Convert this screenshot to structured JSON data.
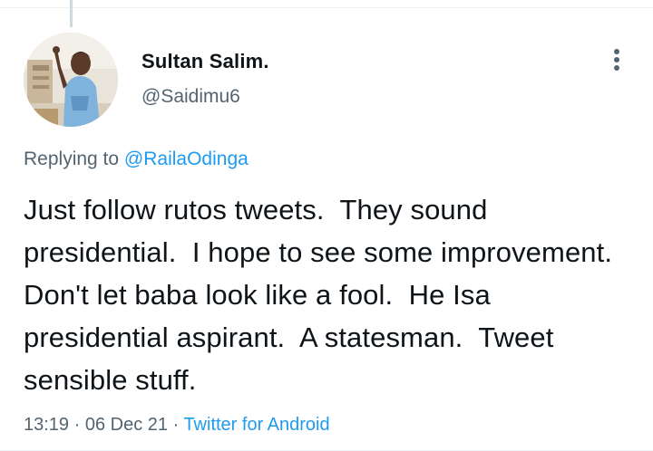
{
  "tweet": {
    "author_name": "Sultan Salim.",
    "author_handle": "@Saidimu6",
    "replying_prefix": "Replying to ",
    "replying_to": "@RailaOdinga",
    "text": "Just follow rutos tweets.  They sound presidential.  I hope to see some improvement.  Don't let baba look like a fool.  He Isa presidential aspirant.  A statesman.  Tweet sensible stuff.",
    "time": "13:19",
    "separator": " · ",
    "date": "06 Dec 21",
    "source": "Twitter for Android"
  },
  "icons": {
    "more": "more-vertical-icon",
    "avatar": "profile-photo"
  },
  "colors": {
    "accent": "#1d9bf0",
    "secondary_text": "#536471",
    "primary_text": "#0f1419",
    "border": "#eff3f4",
    "thread_line": "#cfd9de"
  }
}
